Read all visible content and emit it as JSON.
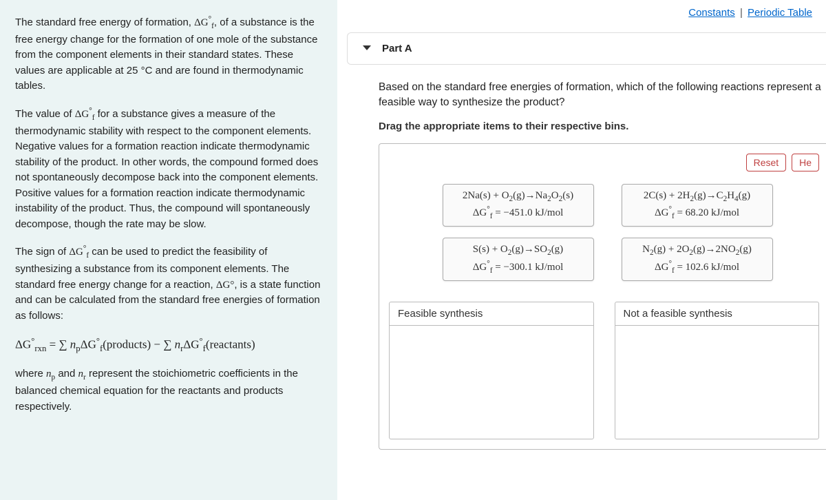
{
  "topLinks": {
    "constants": "Constants",
    "periodic": "Periodic Table"
  },
  "intro": {
    "para1_pre": "The standard free energy of formation, ",
    "para1_sym": "ΔG",
    "para1_post": ", of a substance is the free energy change for the formation of one mole of the substance from the component elements in their standard states. These values are applicable at 25 °C and are found in thermodynamic tables.",
    "para2_pre": "The value of ",
    "para2_post": " for a substance gives a measure of the thermodynamic stability with respect to the component elements. Negative values for a formation reaction indicate thermodynamic stability of the product. In other words, the compound formed does not spontaneously decompose back into the component elements. Positive values for a formation reaction indicate thermodynamic instability of the product. Thus, the compound will spontaneously decompose, though the rate may be slow.",
    "para3_pre": "The sign of ",
    "para3_mid": " can be used to predict the feasibility of synthesizing a substance from its component elements. The standard free energy change for a reaction, ",
    "para3_sym2": "ΔG°",
    "para3_post": ", is a state function and can be calculated from the standard free energies of formation as follows:",
    "equation_lhs": "ΔG°",
    "equation_rxn": "rxn",
    "equation_eq": " = ",
    "equation_sum1": "∑ n",
    "equation_p": "p",
    "equation_dg": "ΔG",
    "equation_prod": "(products)",
    "equation_minus": " − ",
    "equation_r": "r",
    "equation_react": "(reactants)",
    "para4_pre": "where ",
    "para4_np": "n",
    "para4_and": " and ",
    "para4_post": " represent the stoichiometric coefficients in the balanced chemical equation for the reactants and products respectively."
  },
  "part": {
    "label": "Part A",
    "question": "Based on the standard free energies of formation, which of the following reactions represent a feasible way to synthesize the product?",
    "instruction": "Drag the appropriate items to their respective bins."
  },
  "buttons": {
    "reset": "Reset",
    "help": "He"
  },
  "items": [
    {
      "reaction": "2Na(s) + O₂(g)→Na₂O₂(s)",
      "dg": "ΔG°f = −451.0 kJ/mol"
    },
    {
      "reaction": "2C(s) + 2H₂(g)→C₂H₄(g)",
      "dg": "ΔG°f = 68.20 kJ/mol"
    },
    {
      "reaction": "S(s) + O₂(g)→SO₂(g)",
      "dg": "ΔG°f = −300.1 kJ/mol"
    },
    {
      "reaction": "N₂(g) + 2O₂(g)→2NO₂(g)",
      "dg": "ΔG°f = 102.6 kJ/mol"
    }
  ],
  "bins": {
    "feasible": "Feasible synthesis",
    "notFeasible": "Not a feasible synthesis"
  }
}
